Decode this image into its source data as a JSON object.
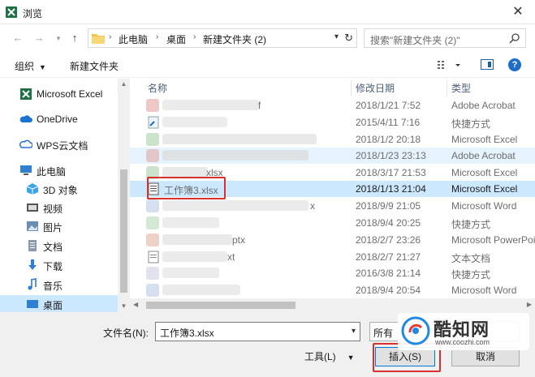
{
  "window": {
    "title": "浏览",
    "close": "✕"
  },
  "address_bar": {
    "crumbs": [
      "此电脑",
      "桌面",
      "新建文件夹 (2)"
    ],
    "search_placeholder": "搜索\"新建文件夹 (2)\""
  },
  "toolbar": {
    "organize": "组织",
    "new_folder": "新建文件夹",
    "help": "?"
  },
  "nav": {
    "items": [
      {
        "label": "Microsoft Excel",
        "icon": "excel-icon"
      },
      {
        "label": "OneDrive",
        "icon": "cloud-icon"
      },
      {
        "label": "WPS云文档",
        "icon": "wps-cloud-icon"
      },
      {
        "label": "此电脑",
        "icon": "computer-icon"
      },
      {
        "label": "3D 对象",
        "icon": "cube-icon"
      },
      {
        "label": "视频",
        "icon": "video-icon"
      },
      {
        "label": "图片",
        "icon": "picture-icon"
      },
      {
        "label": "文档",
        "icon": "document-icon"
      },
      {
        "label": "下载",
        "icon": "download-icon"
      },
      {
        "label": "音乐",
        "icon": "music-icon"
      },
      {
        "label": "桌面",
        "icon": "desktop-icon"
      }
    ]
  },
  "columns": {
    "name": "名称",
    "date": "修改日期",
    "type": "类型"
  },
  "files": [
    {
      "name": "f",
      "date": "2018/1/21 7:52",
      "type": "Adobe Acrobat"
    },
    {
      "name": "",
      "date": "2015/4/11 7:16",
      "type": "快捷方式"
    },
    {
      "name": "",
      "date": "2018/1/2 20:18",
      "type": "Microsoft Excel"
    },
    {
      "name": "",
      "date": "2018/1/23 23:13",
      "type": "Adobe Acrobat"
    },
    {
      "name": "xlsx",
      "date": "2018/3/17 21:53",
      "type": "Microsoft Excel"
    },
    {
      "name": "工作簿3.xlsx",
      "date": "2018/1/13 21:04",
      "type": "Microsoft Excel"
    },
    {
      "name": "x",
      "date": "2018/9/9 21:05",
      "type": "Microsoft Word"
    },
    {
      "name": "",
      "date": "2018/9/4 20:25",
      "type": "快捷方式"
    },
    {
      "name": "ptx",
      "date": "2018/2/7 23:26",
      "type": "Microsoft PowerPoint"
    },
    {
      "name": "xt",
      "date": "2018/2/7 21:27",
      "type": "文本文档"
    },
    {
      "name": "",
      "date": "2016/3/8 21:14",
      "type": "快捷方式"
    },
    {
      "name": "",
      "date": "2018/9/4 20:54",
      "type": "Microsoft Word"
    }
  ],
  "bottom": {
    "filename_label": "文件名(N):",
    "filename_value": "工作簿3.xlsx",
    "filetype_value": "所有",
    "tools": "工具(L)",
    "insert": "插入(S)",
    "cancel": "取消"
  },
  "watermark": {
    "brand": "酷知网",
    "url": "www.coozhi.com"
  },
  "colors": {
    "selection": "#cce8ff",
    "hover": "#e5f3ff",
    "highlight_box": "#d9302f",
    "accent": "#0078d7"
  }
}
